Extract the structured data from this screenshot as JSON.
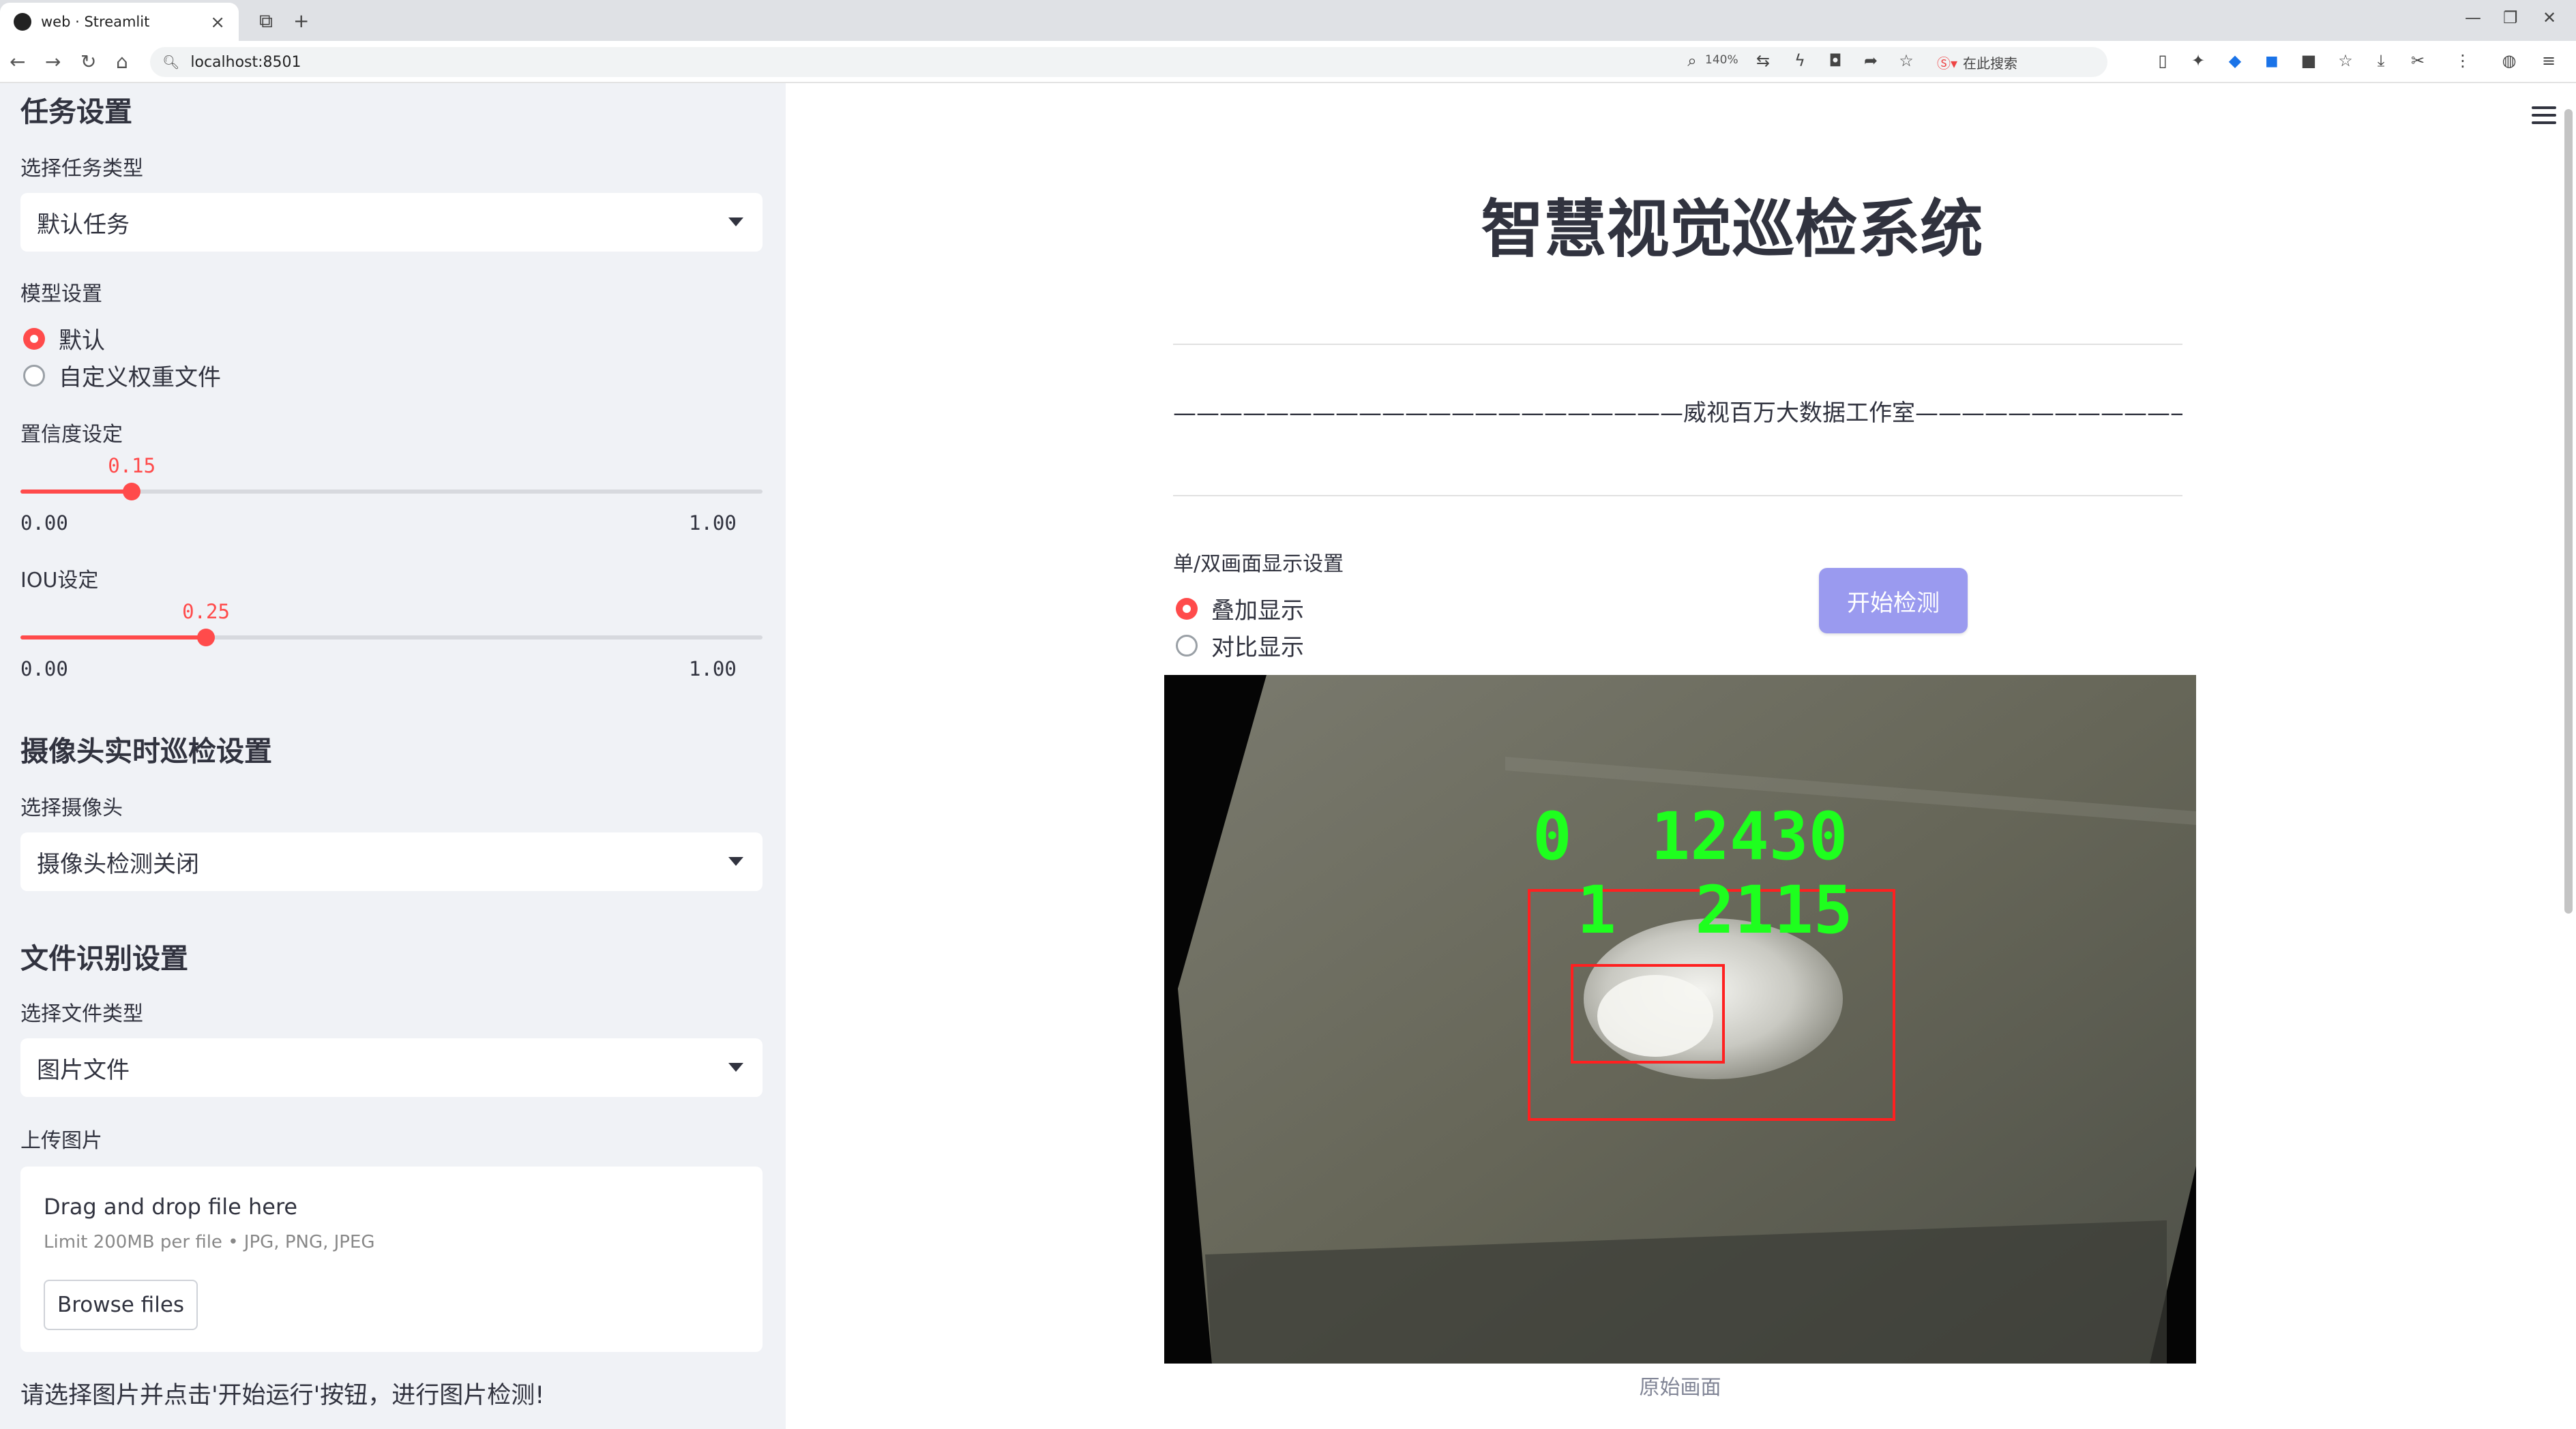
{
  "browser": {
    "tab_title": "web · Streamlit",
    "url": "localhost:8501",
    "zoom": "140%",
    "search_placeholder": "在此搜索"
  },
  "sidebar": {
    "task_header": "任务设置",
    "task_type_label": "选择任务类型",
    "task_type_value": "默认任务",
    "model_label": "模型设置",
    "model_options": [
      "默认",
      "自定义权重文件"
    ],
    "model_selected": 0,
    "conf_label": "置信度设定",
    "conf": {
      "value": "0.15",
      "min": "0.00",
      "max": "1.00",
      "fraction": 0.15
    },
    "iou_label": "IOU设定",
    "iou": {
      "value": "0.25",
      "min": "0.00",
      "max": "1.00",
      "fraction": 0.25
    },
    "camera_header": "摄像头实时巡检设置",
    "camera_label": "选择摄像头",
    "camera_value": "摄像头检测关闭",
    "file_header": "文件识别设置",
    "file_type_label": "选择文件类型",
    "file_type_value": "图片文件",
    "upload_label": "上传图片",
    "upload_drag": "Drag and drop file here",
    "upload_limit": "Limit 200MB per file • JPG, PNG, JPEG",
    "browse_label": "Browse files",
    "hint": "请选择图片并点击'开始运行'按钮，进行图片检测!"
  },
  "main": {
    "title": "智慧视觉巡检系统",
    "subtitle": "——————————————————————威视百万大数据工作室———————————————————————",
    "display_label": "单/双画面显示设置",
    "display_options": [
      "叠加显示",
      "对比显示"
    ],
    "display_selected": 0,
    "start_button": "开始检测",
    "image_caption": "原始画面",
    "detections": [
      {
        "label": "0  12430"
      },
      {
        "label": "1  2115"
      }
    ]
  },
  "colors": {
    "accent": "#ff4b4b",
    "button": "#9a9aef",
    "sidebar_bg": "#f0f2f6",
    "box": "#ff2020",
    "det_text": "#1eff1e"
  }
}
